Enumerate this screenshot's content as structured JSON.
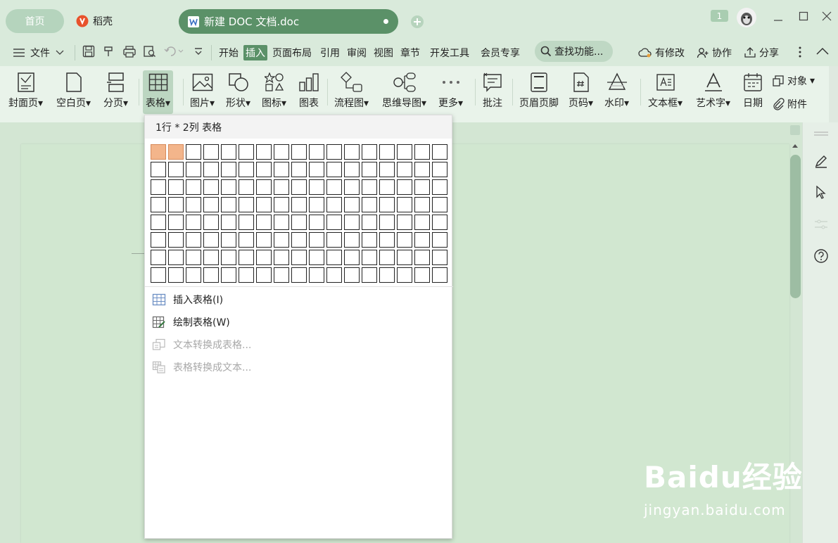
{
  "titlebar": {
    "home_tab": "首页",
    "daoke_tab": "稻壳",
    "doc_tab": "新建 DOC 文档.doc",
    "badge": "1"
  },
  "menubar": {
    "file_label": "文件",
    "tabs": [
      "开始",
      "插入",
      "页面布局",
      "引用",
      "审阅",
      "视图",
      "章节",
      "开发工具",
      "会员专享"
    ],
    "active_tab": "插入",
    "search_label": "查找功能...",
    "has_changes_label": "有修改",
    "collaborate_label": "协作",
    "share_label": "分享"
  },
  "ribbon": {
    "items": [
      {
        "label": "封面页",
        "dropdown": true
      },
      {
        "label": "空白页",
        "dropdown": true
      },
      {
        "label": "分页",
        "dropdown": true
      },
      {
        "label": "表格",
        "dropdown": true,
        "selected": true
      },
      {
        "label": "图片",
        "dropdown": true
      },
      {
        "label": "形状",
        "dropdown": true
      },
      {
        "label": "图标",
        "dropdown": true
      },
      {
        "label": "图表",
        "dropdown": false
      },
      {
        "label": "流程图",
        "dropdown": true
      },
      {
        "label": "思维导图",
        "dropdown": true
      },
      {
        "label": "更多",
        "dropdown": true
      },
      {
        "label": "批注",
        "dropdown": false
      },
      {
        "label": "页眉页脚",
        "dropdown": false
      },
      {
        "label": "页码",
        "dropdown": true
      },
      {
        "label": "水印",
        "dropdown": true
      },
      {
        "label": "文本框",
        "dropdown": true
      },
      {
        "label": "艺术字",
        "dropdown": true
      },
      {
        "label": "日期",
        "dropdown": false
      }
    ],
    "object_label": "对象",
    "attachment_label": "附件"
  },
  "table_dropdown": {
    "header": "1行 * 2列 表格",
    "grid_rows": 8,
    "grid_cols": 17,
    "selected_rows": 1,
    "selected_cols": 2,
    "menu": [
      {
        "label": "插入表格(I)",
        "enabled": true,
        "icon": "insert-table-icon"
      },
      {
        "label": "绘制表格(W)",
        "enabled": true,
        "icon": "draw-table-icon"
      },
      {
        "label": "文本转换成表格...",
        "enabled": false,
        "icon": "text-to-table-icon"
      },
      {
        "label": "表格转换成文本...",
        "enabled": false,
        "icon": "table-to-text-icon"
      }
    ]
  },
  "watermark": {
    "brand": "Baidu经验",
    "url": "jingyan.baidu.com"
  },
  "colors": {
    "accent": "#5b9168",
    "highlight_cell": "#f3b58b",
    "background": "#d3e6d3"
  }
}
